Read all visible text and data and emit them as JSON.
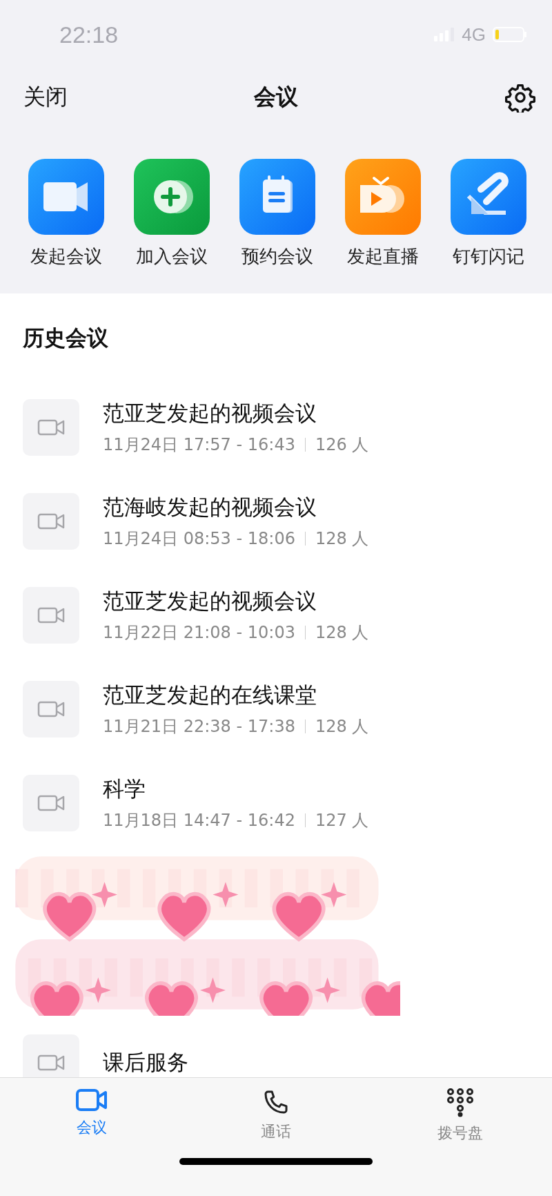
{
  "status_bar": {
    "time": "22:18",
    "network": "4G"
  },
  "header": {
    "close": "关闭",
    "title": "会议"
  },
  "actions": [
    {
      "kind": "start",
      "label": "发起会议"
    },
    {
      "kind": "join",
      "label": "加入会议"
    },
    {
      "kind": "schedule",
      "label": "预约会议"
    },
    {
      "kind": "live",
      "label": "发起直播"
    },
    {
      "kind": "notes",
      "label": "钉钉闪记"
    }
  ],
  "history": {
    "title": "历史会议",
    "items": [
      {
        "title": "范亚芝发起的视频会议",
        "time": "11月24日 17:57 - 16:43",
        "people": "126 人"
      },
      {
        "title": "范海岐发起的视频会议",
        "time": "11月24日 08:53 - 18:06",
        "people": "128 人"
      },
      {
        "title": "范亚芝发起的视频会议",
        "time": "11月22日 21:08 - 10:03",
        "people": "128 人"
      },
      {
        "title": "范亚芝发起的在线课堂",
        "time": "11月21日 22:38 - 17:38",
        "people": "128 人"
      },
      {
        "title": "科学",
        "time": "11月18日 14:47 - 16:42",
        "people": "127 人"
      },
      {
        "title": "课后服务"
      }
    ]
  },
  "tabs": [
    {
      "kind": "meeting",
      "label": "会议",
      "selected": true
    },
    {
      "kind": "call",
      "label": "通话",
      "selected": false
    },
    {
      "kind": "dialpad",
      "label": "拨号盘",
      "selected": false
    }
  ]
}
